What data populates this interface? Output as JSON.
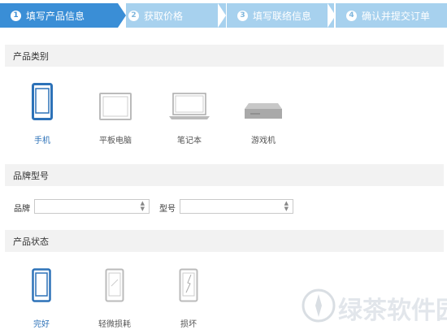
{
  "steps": [
    {
      "num": "1",
      "label": "填写产品信息",
      "active": true
    },
    {
      "num": "2",
      "label": "获取价格",
      "active": false
    },
    {
      "num": "3",
      "label": "填写联络信息",
      "active": false
    },
    {
      "num": "4",
      "label": "确认并提交订单",
      "active": false
    }
  ],
  "colors": {
    "active_step": "#3a8ed6",
    "inactive_step": "#a7d1ee",
    "selected": "#2d72b8",
    "section_bg": "#f2f2f2"
  },
  "category": {
    "title": "产品类别",
    "items": [
      {
        "label": "手机",
        "icon": "phone-icon",
        "selected": true
      },
      {
        "label": "平板电脑",
        "icon": "tablet-icon",
        "selected": false
      },
      {
        "label": "笔记本",
        "icon": "laptop-icon",
        "selected": false
      },
      {
        "label": "游戏机",
        "icon": "game-console-icon",
        "selected": false
      }
    ]
  },
  "model": {
    "title": "品牌型号",
    "brand_label": "品牌",
    "brand_value": "",
    "type_label": "型号",
    "type_value": ""
  },
  "condition": {
    "title": "产品状态",
    "items": [
      {
        "label": "完好",
        "icon": "phone-intact-icon",
        "selected": true
      },
      {
        "label": "轻微损耗",
        "icon": "phone-worn-icon",
        "selected": false
      },
      {
        "label": "损坏",
        "icon": "phone-broken-icon",
        "selected": false
      }
    ]
  },
  "watermark": {
    "text": "绿茶软件园"
  }
}
